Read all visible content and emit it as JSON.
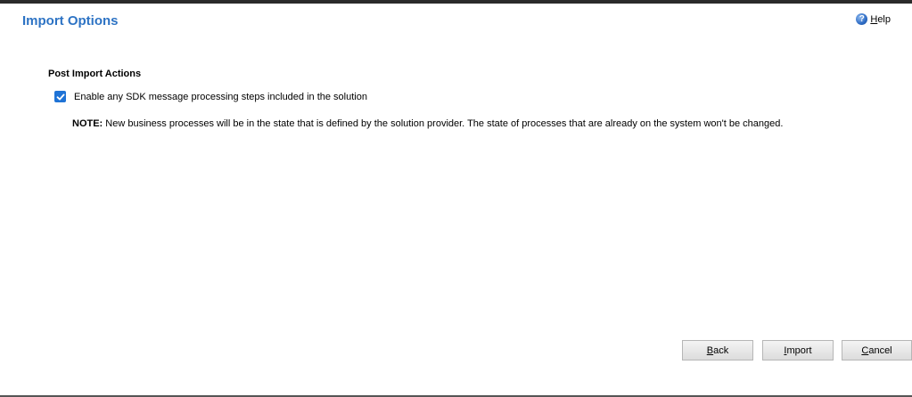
{
  "header": {
    "title": "Import Options",
    "help": {
      "access_key": "H",
      "rest": "elp"
    }
  },
  "post_import": {
    "section_title": "Post Import Actions",
    "checkbox_label": "Enable any SDK message processing steps included in the solution",
    "checkbox_checked": true,
    "note_label": "NOTE:",
    "note_text": " New business processes will be in the state that is defined by the solution provider. The state of processes that are already on the system won't be changed."
  },
  "buttons": {
    "back": {
      "access_key": "B",
      "rest": "ack"
    },
    "import": {
      "access_key": "I",
      "rest": "mport"
    },
    "cancel": {
      "access_key": "C",
      "rest": "ancel"
    }
  },
  "colors": {
    "title": "#2d73c4",
    "checkbox": "#1f73d6",
    "top_border": "#2b2b2b"
  },
  "icons": {
    "help": "help-icon",
    "checkbox": "checkmark-icon"
  }
}
